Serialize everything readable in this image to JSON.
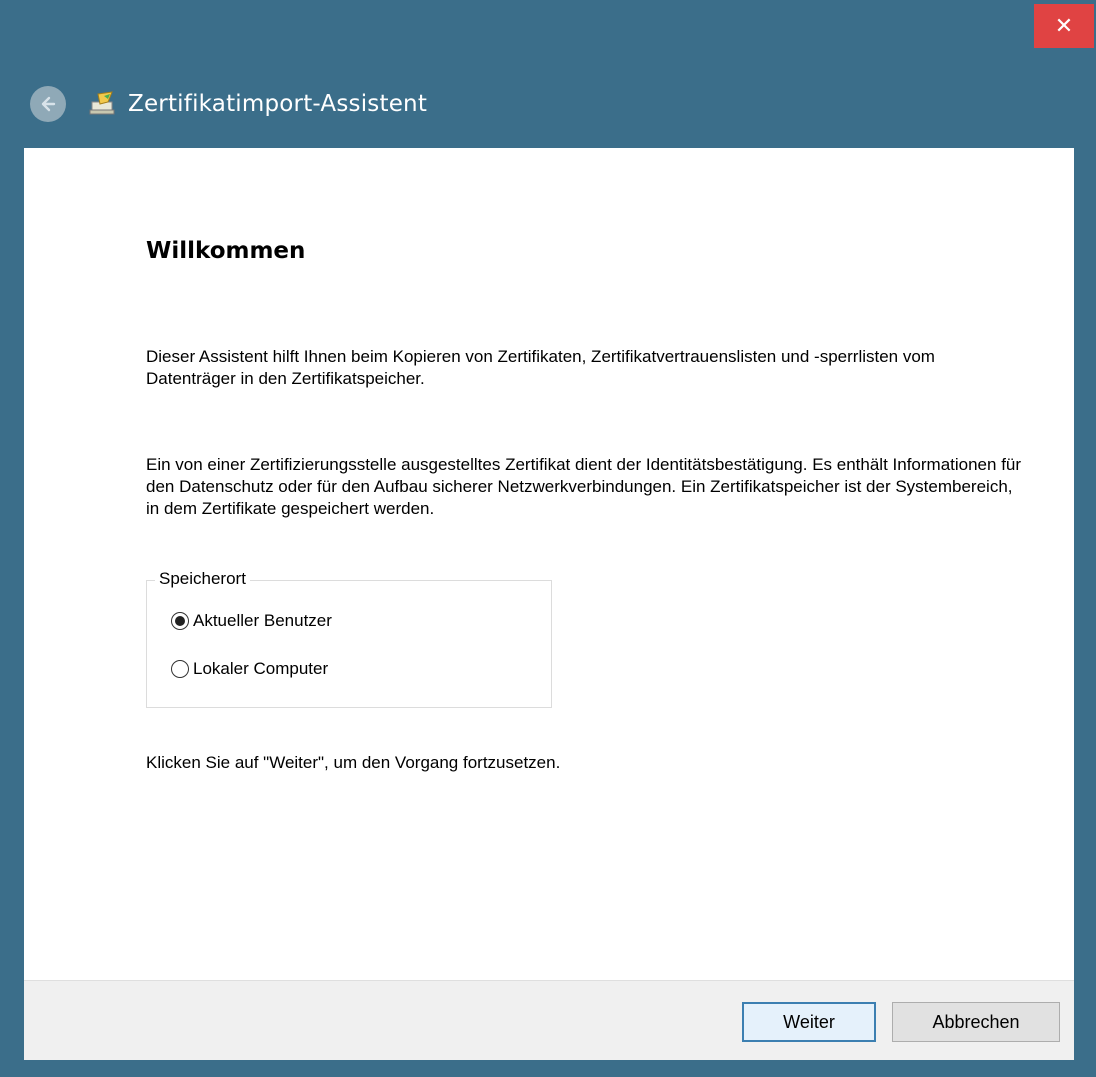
{
  "window": {
    "title": "Zertifikatimport-Assistent",
    "close_symbol": "✕",
    "accent_color": "#3b6e8a",
    "close_color": "#e04343"
  },
  "icons": {
    "back": "back-arrow-icon",
    "app": "certificate-wizard-icon",
    "close": "close-icon"
  },
  "content": {
    "heading": "Willkommen",
    "paragraph_1": "Dieser Assistent hilft Ihnen beim Kopieren von Zertifikaten, Zertifikatvertrauenslisten und -sperrlisten vom Datenträger in den Zertifikatspeicher.",
    "paragraph_2": "Ein von einer Zertifizierungsstelle ausgestelltes Zertifikat dient der Identitätsbestätigung. Es enthält Informationen für den Datenschutz oder für den Aufbau sicherer Netzwerkverbindungen. Ein Zertifikatspeicher ist der Systembereich, in dem Zertifikate gespeichert werden.",
    "store_location": {
      "legend": "Speicherort",
      "options": [
        {
          "label": "Aktueller Benutzer",
          "selected": true
        },
        {
          "label": "Lokaler Computer",
          "selected": false
        }
      ]
    },
    "paragraph_3": "Klicken Sie auf \"Weiter\", um den Vorgang fortzusetzen."
  },
  "footer": {
    "next_label": "Weiter",
    "cancel_label": "Abbrechen"
  }
}
